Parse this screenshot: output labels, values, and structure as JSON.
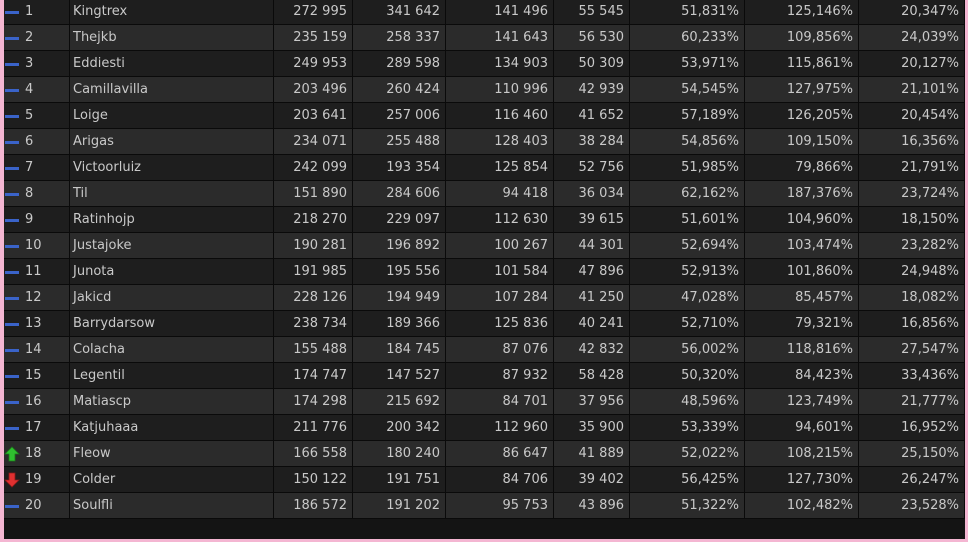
{
  "rows": [
    {
      "rank": "1",
      "trend": "steady-icon",
      "name": "Kingtrex",
      "c1": "272 995",
      "c2": "341 642",
      "c3": "141 496",
      "c4": "55 545",
      "p1": "51,831%",
      "p2": "125,146%",
      "p3": "20,347%"
    },
    {
      "rank": "2",
      "trend": "steady-icon",
      "name": "Thejkb",
      "c1": "235 159",
      "c2": "258 337",
      "c3": "141 643",
      "c4": "56 530",
      "p1": "60,233%",
      "p2": "109,856%",
      "p3": "24,039%"
    },
    {
      "rank": "3",
      "trend": "steady-icon",
      "name": "Eddiesti",
      "c1": "249 953",
      "c2": "289 598",
      "c3": "134 903",
      "c4": "50 309",
      "p1": "53,971%",
      "p2": "115,861%",
      "p3": "20,127%"
    },
    {
      "rank": "4",
      "trend": "steady-icon",
      "name": "Camillavilla",
      "c1": "203 496",
      "c2": "260 424",
      "c3": "110 996",
      "c4": "42 939",
      "p1": "54,545%",
      "p2": "127,975%",
      "p3": "21,101%"
    },
    {
      "rank": "5",
      "trend": "steady-icon",
      "name": "Loige",
      "c1": "203 641",
      "c2": "257 006",
      "c3": "116 460",
      "c4": "41 652",
      "p1": "57,189%",
      "p2": "126,205%",
      "p3": "20,454%"
    },
    {
      "rank": "6",
      "trend": "steady-icon",
      "name": "Arigas",
      "c1": "234 071",
      "c2": "255 488",
      "c3": "128 403",
      "c4": "38 284",
      "p1": "54,856%",
      "p2": "109,150%",
      "p3": "16,356%"
    },
    {
      "rank": "7",
      "trend": "steady-icon",
      "name": "Victoorluiz",
      "c1": "242 099",
      "c2": "193 354",
      "c3": "125 854",
      "c4": "52 756",
      "p1": "51,985%",
      "p2": "79,866%",
      "p3": "21,791%"
    },
    {
      "rank": "8",
      "trend": "steady-icon",
      "name": "Til",
      "c1": "151 890",
      "c2": "284 606",
      "c3": "94 418",
      "c4": "36 034",
      "p1": "62,162%",
      "p2": "187,376%",
      "p3": "23,724%"
    },
    {
      "rank": "9",
      "trend": "steady-icon",
      "name": "Ratinhojp",
      "c1": "218 270",
      "c2": "229 097",
      "c3": "112 630",
      "c4": "39 615",
      "p1": "51,601%",
      "p2": "104,960%",
      "p3": "18,150%"
    },
    {
      "rank": "10",
      "trend": "steady-icon",
      "name": "Justajoke",
      "c1": "190 281",
      "c2": "196 892",
      "c3": "100 267",
      "c4": "44 301",
      "p1": "52,694%",
      "p2": "103,474%",
      "p3": "23,282%"
    },
    {
      "rank": "11",
      "trend": "steady-icon",
      "name": "Junota",
      "c1": "191 985",
      "c2": "195 556",
      "c3": "101 584",
      "c4": "47 896",
      "p1": "52,913%",
      "p2": "101,860%",
      "p3": "24,948%"
    },
    {
      "rank": "12",
      "trend": "steady-icon",
      "name": "Jakicd",
      "c1": "228 126",
      "c2": "194 949",
      "c3": "107 284",
      "c4": "41 250",
      "p1": "47,028%",
      "p2": "85,457%",
      "p3": "18,082%"
    },
    {
      "rank": "13",
      "trend": "steady-icon",
      "name": "Barrydarsow",
      "c1": "238 734",
      "c2": "189 366",
      "c3": "125 836",
      "c4": "40 241",
      "p1": "52,710%",
      "p2": "79,321%",
      "p3": "16,856%"
    },
    {
      "rank": "14",
      "trend": "steady-icon",
      "name": "Colacha",
      "c1": "155 488",
      "c2": "184 745",
      "c3": "87 076",
      "c4": "42 832",
      "p1": "56,002%",
      "p2": "118,816%",
      "p3": "27,547%"
    },
    {
      "rank": "15",
      "trend": "steady-icon",
      "name": "Legentil",
      "c1": "174 747",
      "c2": "147 527",
      "c3": "87 932",
      "c4": "58 428",
      "p1": "50,320%",
      "p2": "84,423%",
      "p3": "33,436%"
    },
    {
      "rank": "16",
      "trend": "steady-icon",
      "name": "Matiascp",
      "c1": "174 298",
      "c2": "215 692",
      "c3": "84 701",
      "c4": "37 956",
      "p1": "48,596%",
      "p2": "123,749%",
      "p3": "21,777%"
    },
    {
      "rank": "17",
      "trend": "steady-icon",
      "name": "Katjuhaaa",
      "c1": "211 776",
      "c2": "200 342",
      "c3": "112 960",
      "c4": "35 900",
      "p1": "53,339%",
      "p2": "94,601%",
      "p3": "16,952%"
    },
    {
      "rank": "18",
      "trend": "up-arrow-icon",
      "name": "Fleow",
      "c1": "166 558",
      "c2": "180 240",
      "c3": "86 647",
      "c4": "41 889",
      "p1": "52,022%",
      "p2": "108,215%",
      "p3": "25,150%"
    },
    {
      "rank": "19",
      "trend": "down-arrow-icon",
      "name": "Colder",
      "c1": "150 122",
      "c2": "191 751",
      "c3": "84 706",
      "c4": "39 402",
      "p1": "56,425%",
      "p2": "127,730%",
      "p3": "26,247%"
    },
    {
      "rank": "20",
      "trend": "steady-icon",
      "name": "Soulfli",
      "c1": "186 572",
      "c2": "191 202",
      "c3": "95 753",
      "c4": "43 896",
      "p1": "51,322%",
      "p2": "102,482%",
      "p3": "23,528%"
    }
  ],
  "colors": {
    "steady": "#3a63c9",
    "up": "#2fc02f",
    "down": "#e03030",
    "row_even": "#2b2b2b",
    "row_odd": "#1e1e1e",
    "text": "#c9c9c9",
    "page_border": "#f4b6d2"
  }
}
